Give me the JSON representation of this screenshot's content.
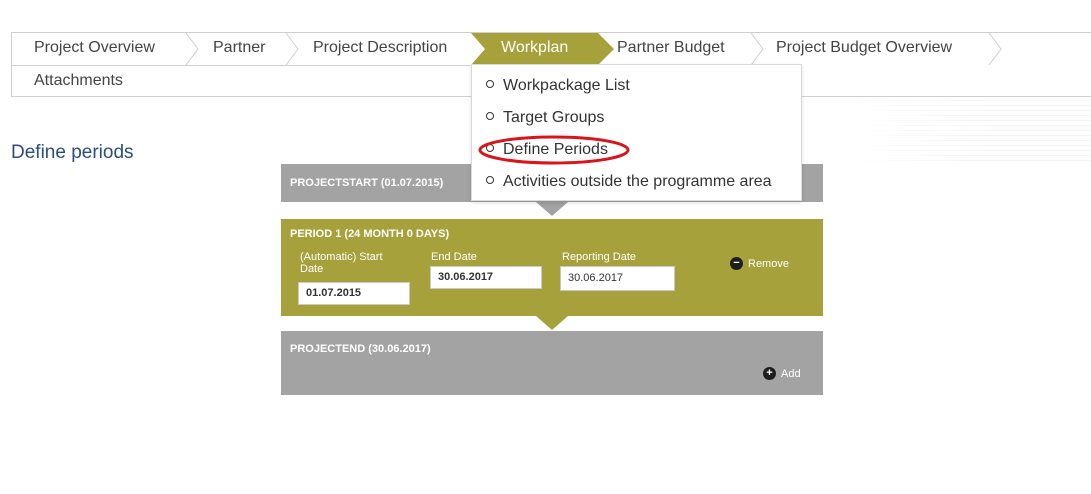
{
  "tabs": {
    "row1": [
      {
        "label": "Project Overview",
        "active": false
      },
      {
        "label": "Partner",
        "active": false
      },
      {
        "label": "Project Description",
        "active": false
      },
      {
        "label": "Workplan",
        "active": true
      },
      {
        "label": "Partner Budget",
        "active": false
      },
      {
        "label": "Project Budget Overview",
        "active": false
      }
    ],
    "row2": [
      {
        "label": "Attachments",
        "active": false
      }
    ]
  },
  "workplan_menu": {
    "items": [
      {
        "label": "Workpackage List"
      },
      {
        "label": "Target Groups"
      },
      {
        "label": "Define Periods",
        "highlighted": true
      },
      {
        "label": "Activities outside the programme area"
      }
    ]
  },
  "page": {
    "title": "Define periods"
  },
  "periods": {
    "project_start": "PROJECTSTART (01.07.2015)",
    "period1": {
      "title": "PERIOD 1 (24 MONTH 0 DAYS)",
      "start_label_line1": "(Automatic) Start",
      "start_label_line2": "Date",
      "start_value": "01.07.2015",
      "end_label": "End Date",
      "end_value": "30.06.2017",
      "reporting_label": "Reporting Date",
      "reporting_value": "30.06.2017",
      "remove_label": "Remove"
    },
    "project_end": "PROJECTEND (30.06.2017)",
    "add_label": "Add"
  },
  "colors": {
    "active_tab": "#a7a13b",
    "period_block": "#a7a13b",
    "boundary_block": "#a3a3a3",
    "title_blue": "#2b4f7a",
    "highlight_ring": "#d9141b"
  },
  "icons": {
    "remove": "minus-circle-icon",
    "add": "plus-circle-icon",
    "tab_separator": "chevron-right-icon",
    "menu_bullet": "circle-bullet-icon"
  }
}
